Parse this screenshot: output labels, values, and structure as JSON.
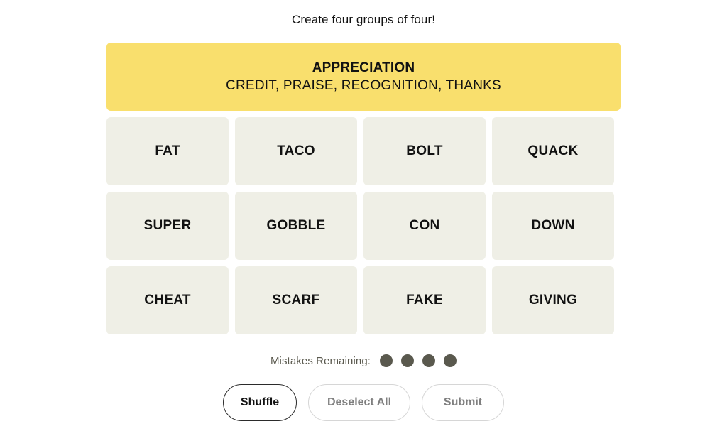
{
  "instruction": "Create four groups of four!",
  "solved": [
    {
      "title": "APPRECIATION",
      "members": "CREDIT, PRAISE, RECOGNITION, THANKS",
      "color": "#f9df6d"
    }
  ],
  "tiles": [
    [
      {
        "label": "FAT"
      },
      {
        "label": "TACO"
      },
      {
        "label": "BOLT"
      },
      {
        "label": "QUACK"
      }
    ],
    [
      {
        "label": "SUPER"
      },
      {
        "label": "GOBBLE"
      },
      {
        "label": "CON"
      },
      {
        "label": "DOWN"
      }
    ],
    [
      {
        "label": "CHEAT"
      },
      {
        "label": "SCARF"
      },
      {
        "label": "FAKE"
      },
      {
        "label": "GIVING"
      }
    ]
  ],
  "mistakes": {
    "label": "Mistakes Remaining:",
    "remaining": 4,
    "dot_color": "#5a594e"
  },
  "buttons": {
    "shuffle": "Shuffle",
    "deselect": "Deselect All",
    "submit": "Submit"
  }
}
